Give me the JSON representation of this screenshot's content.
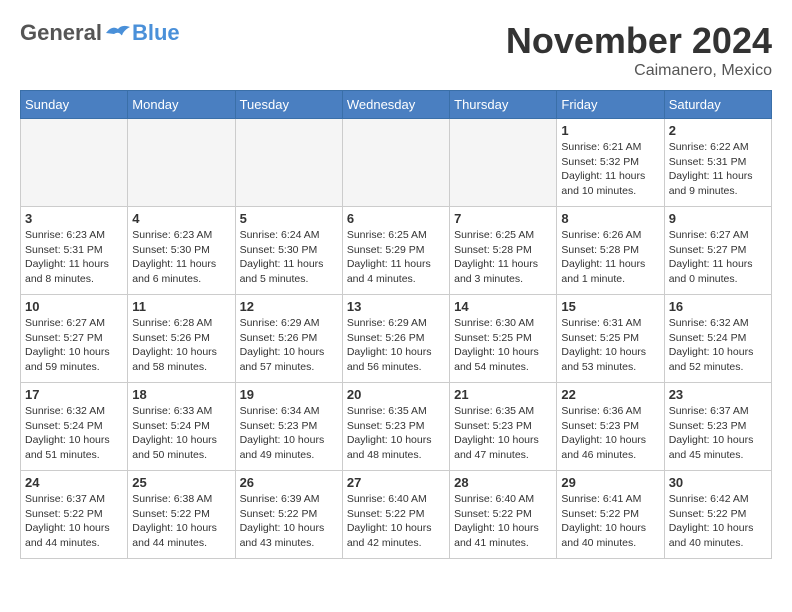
{
  "logo": {
    "general": "General",
    "blue": "Blue"
  },
  "title": "November 2024",
  "location": "Caimanero, Mexico",
  "days_of_week": [
    "Sunday",
    "Monday",
    "Tuesday",
    "Wednesday",
    "Thursday",
    "Friday",
    "Saturday"
  ],
  "weeks": [
    [
      {
        "day": "",
        "empty": true
      },
      {
        "day": "",
        "empty": true
      },
      {
        "day": "",
        "empty": true
      },
      {
        "day": "",
        "empty": true
      },
      {
        "day": "",
        "empty": true
      },
      {
        "day": "1",
        "info": "Sunrise: 6:21 AM\nSunset: 5:32 PM\nDaylight: 11 hours and 10 minutes."
      },
      {
        "day": "2",
        "info": "Sunrise: 6:22 AM\nSunset: 5:31 PM\nDaylight: 11 hours and 9 minutes."
      }
    ],
    [
      {
        "day": "3",
        "info": "Sunrise: 6:23 AM\nSunset: 5:31 PM\nDaylight: 11 hours and 8 minutes."
      },
      {
        "day": "4",
        "info": "Sunrise: 6:23 AM\nSunset: 5:30 PM\nDaylight: 11 hours and 6 minutes."
      },
      {
        "day": "5",
        "info": "Sunrise: 6:24 AM\nSunset: 5:30 PM\nDaylight: 11 hours and 5 minutes."
      },
      {
        "day": "6",
        "info": "Sunrise: 6:25 AM\nSunset: 5:29 PM\nDaylight: 11 hours and 4 minutes."
      },
      {
        "day": "7",
        "info": "Sunrise: 6:25 AM\nSunset: 5:28 PM\nDaylight: 11 hours and 3 minutes."
      },
      {
        "day": "8",
        "info": "Sunrise: 6:26 AM\nSunset: 5:28 PM\nDaylight: 11 hours and 1 minute."
      },
      {
        "day": "9",
        "info": "Sunrise: 6:27 AM\nSunset: 5:27 PM\nDaylight: 11 hours and 0 minutes."
      }
    ],
    [
      {
        "day": "10",
        "info": "Sunrise: 6:27 AM\nSunset: 5:27 PM\nDaylight: 10 hours and 59 minutes."
      },
      {
        "day": "11",
        "info": "Sunrise: 6:28 AM\nSunset: 5:26 PM\nDaylight: 10 hours and 58 minutes."
      },
      {
        "day": "12",
        "info": "Sunrise: 6:29 AM\nSunset: 5:26 PM\nDaylight: 10 hours and 57 minutes."
      },
      {
        "day": "13",
        "info": "Sunrise: 6:29 AM\nSunset: 5:26 PM\nDaylight: 10 hours and 56 minutes."
      },
      {
        "day": "14",
        "info": "Sunrise: 6:30 AM\nSunset: 5:25 PM\nDaylight: 10 hours and 54 minutes."
      },
      {
        "day": "15",
        "info": "Sunrise: 6:31 AM\nSunset: 5:25 PM\nDaylight: 10 hours and 53 minutes."
      },
      {
        "day": "16",
        "info": "Sunrise: 6:32 AM\nSunset: 5:24 PM\nDaylight: 10 hours and 52 minutes."
      }
    ],
    [
      {
        "day": "17",
        "info": "Sunrise: 6:32 AM\nSunset: 5:24 PM\nDaylight: 10 hours and 51 minutes."
      },
      {
        "day": "18",
        "info": "Sunrise: 6:33 AM\nSunset: 5:24 PM\nDaylight: 10 hours and 50 minutes."
      },
      {
        "day": "19",
        "info": "Sunrise: 6:34 AM\nSunset: 5:23 PM\nDaylight: 10 hours and 49 minutes."
      },
      {
        "day": "20",
        "info": "Sunrise: 6:35 AM\nSunset: 5:23 PM\nDaylight: 10 hours and 48 minutes."
      },
      {
        "day": "21",
        "info": "Sunrise: 6:35 AM\nSunset: 5:23 PM\nDaylight: 10 hours and 47 minutes."
      },
      {
        "day": "22",
        "info": "Sunrise: 6:36 AM\nSunset: 5:23 PM\nDaylight: 10 hours and 46 minutes."
      },
      {
        "day": "23",
        "info": "Sunrise: 6:37 AM\nSunset: 5:23 PM\nDaylight: 10 hours and 45 minutes."
      }
    ],
    [
      {
        "day": "24",
        "info": "Sunrise: 6:37 AM\nSunset: 5:22 PM\nDaylight: 10 hours and 44 minutes."
      },
      {
        "day": "25",
        "info": "Sunrise: 6:38 AM\nSunset: 5:22 PM\nDaylight: 10 hours and 44 minutes."
      },
      {
        "day": "26",
        "info": "Sunrise: 6:39 AM\nSunset: 5:22 PM\nDaylight: 10 hours and 43 minutes."
      },
      {
        "day": "27",
        "info": "Sunrise: 6:40 AM\nSunset: 5:22 PM\nDaylight: 10 hours and 42 minutes."
      },
      {
        "day": "28",
        "info": "Sunrise: 6:40 AM\nSunset: 5:22 PM\nDaylight: 10 hours and 41 minutes."
      },
      {
        "day": "29",
        "info": "Sunrise: 6:41 AM\nSunset: 5:22 PM\nDaylight: 10 hours and 40 minutes."
      },
      {
        "day": "30",
        "info": "Sunrise: 6:42 AM\nSunset: 5:22 PM\nDaylight: 10 hours and 40 minutes."
      }
    ]
  ]
}
